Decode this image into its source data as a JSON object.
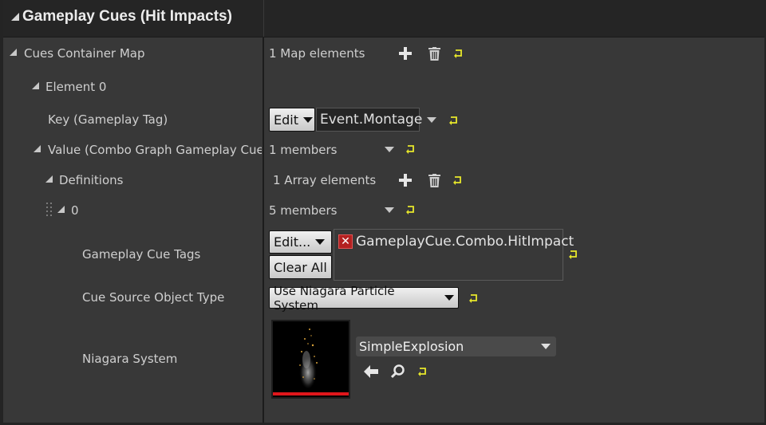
{
  "section": {
    "title": "Gameplay Cues (Hit Impacts)"
  },
  "rows": {
    "cues_container_map": {
      "label": "Cues Container Map",
      "value": "1 Map elements"
    },
    "element_0": {
      "label": "Element 0"
    },
    "key": {
      "label": "Key (Gameplay Tag)",
      "edit_label": "Edit",
      "value": "Event.Montage"
    },
    "value_struct": {
      "label": "Value (Combo Graph Gameplay Cue C",
      "value": "1 members"
    },
    "definitions": {
      "label": "Definitions",
      "value": "1 Array elements"
    },
    "index_0": {
      "label": "0",
      "value": "5 members"
    },
    "gameplay_cue_tags": {
      "label": "Gameplay Cue Tags",
      "edit_label": "Edit...",
      "clear_label": "Clear All",
      "tag": "GameplayCue.Combo.HitImpact"
    },
    "cue_source_object_type": {
      "label": "Cue Source Object Type",
      "value": "Use Niagara Particle System"
    },
    "niagara_system": {
      "label": "Niagara System",
      "value": "SimpleExplosion"
    }
  },
  "icons": {
    "add": "plus-icon",
    "delete": "trash-icon",
    "reset": "reset-to-default-icon",
    "browse_use": "arrow-left-icon",
    "browse_find": "magnifier-icon"
  },
  "colors": {
    "reset_icon": "#e8e82a",
    "tag_remove": "#b32121",
    "thumbnail_bar": "#e0161b"
  }
}
